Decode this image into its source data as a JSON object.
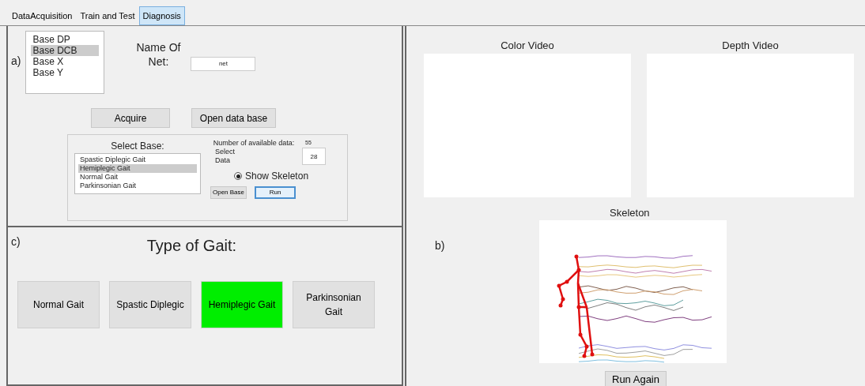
{
  "tabs": [
    {
      "label": "DataAcquisition",
      "selected": false
    },
    {
      "label": "Train and Test",
      "selected": false
    },
    {
      "label": "Diagnosis",
      "selected": true
    }
  ],
  "panel_a": {
    "label": "a)",
    "bases": [
      {
        "label": "Base DP",
        "selected": false
      },
      {
        "label": "Base DCB",
        "selected": true
      },
      {
        "label": "Base X",
        "selected": false
      },
      {
        "label": "Base Y",
        "selected": false
      }
    ],
    "net_name": {
      "label": "Name Of Net:",
      "value": "net"
    },
    "buttons": [
      {
        "label": "Acquire"
      },
      {
        "label": "Open data base"
      }
    ],
    "select_base": {
      "title": "Select Base:",
      "items": [
        {
          "label": "Spastic Diplegic Gait",
          "selected": false
        },
        {
          "label": "Hemiplegic Gait",
          "selected": true
        },
        {
          "label": "Normal Gait",
          "selected": false
        },
        {
          "label": "Parkinsonian Gait",
          "selected": false
        }
      ],
      "available_label": "Number of available data:",
      "available_value": "55",
      "select_data_label": "Select Data",
      "select_data_value": "28",
      "show_skeleton": {
        "label": "Show Skeleton",
        "selected": true
      },
      "buttons": [
        {
          "label": "Open Base",
          "focused": false
        },
        {
          "label": "Run",
          "focused": true
        }
      ]
    }
  },
  "panel_c": {
    "label": "c)",
    "title": "Type of Gait:",
    "gaits": [
      {
        "label": "Normal Gait",
        "selected": false
      },
      {
        "label": "Spastic Diplegic",
        "selected": false
      },
      {
        "label": "Hemiplegic Gait",
        "selected": true
      },
      {
        "label": "Parkinsonian Gait",
        "selected": false
      }
    ]
  },
  "panel_b": {
    "label": "b)",
    "videos": [
      {
        "title": "Color Video"
      },
      {
        "title": "Depth Video"
      }
    ],
    "skeleton_title": "Skeleton",
    "run_again": "Run Again"
  }
}
